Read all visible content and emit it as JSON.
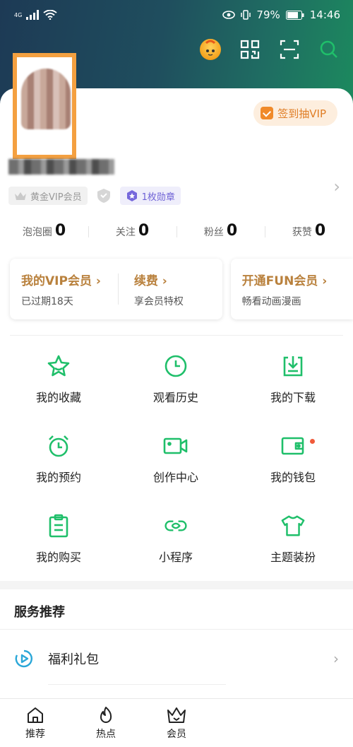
{
  "status_bar": {
    "network": "4G",
    "battery": "79%",
    "time": "14:46"
  },
  "header": {
    "actions": [
      "mascot-icon",
      "qr-code-icon",
      "scan-icon",
      "search-icon"
    ]
  },
  "profile": {
    "sign_in_button": "签到抽VIP",
    "vip_badge": "黄金VIP会员",
    "medal_badge": "1枚勋章"
  },
  "stats": [
    {
      "label": "泡泡圈",
      "value": "0"
    },
    {
      "label": "关注",
      "value": "0"
    },
    {
      "label": "粉丝",
      "value": "0"
    },
    {
      "label": "获赞",
      "value": "0"
    }
  ],
  "vip_cards": {
    "my_vip": {
      "title": "我的VIP会员 ›",
      "sub": "已过期18天"
    },
    "renew": {
      "title": "续费 ›",
      "sub": "享会员特权"
    },
    "fun": {
      "title": "开通FUN会员 ›",
      "sub": "畅看动画漫画"
    }
  },
  "grid": [
    {
      "label": "我的收藏",
      "icon": "star-icon"
    },
    {
      "label": "观看历史",
      "icon": "clock-icon"
    },
    {
      "label": "我的下载",
      "icon": "download-icon"
    },
    {
      "label": "我的预约",
      "icon": "alarm-icon"
    },
    {
      "label": "创作中心",
      "icon": "video-camera-icon"
    },
    {
      "label": "我的钱包",
      "icon": "wallet-icon"
    },
    {
      "label": "我的购买",
      "icon": "clipboard-icon"
    },
    {
      "label": "小程序",
      "icon": "link-icon"
    },
    {
      "label": "主题装扮",
      "icon": "shirt-icon"
    }
  ],
  "services": {
    "title": "服务推荐",
    "items": [
      {
        "label": "福利礼包"
      }
    ]
  },
  "bottom_nav": [
    {
      "label": "推荐",
      "icon": "home-icon"
    },
    {
      "label": "热点",
      "icon": "flame-icon"
    },
    {
      "label": "会员",
      "icon": "crown-icon"
    }
  ],
  "colors": {
    "accent_green": "#1fbf6a",
    "vip_gold": "#b9813d",
    "sign_orange": "#e07d25",
    "medal_purple": "#6f63d6"
  }
}
